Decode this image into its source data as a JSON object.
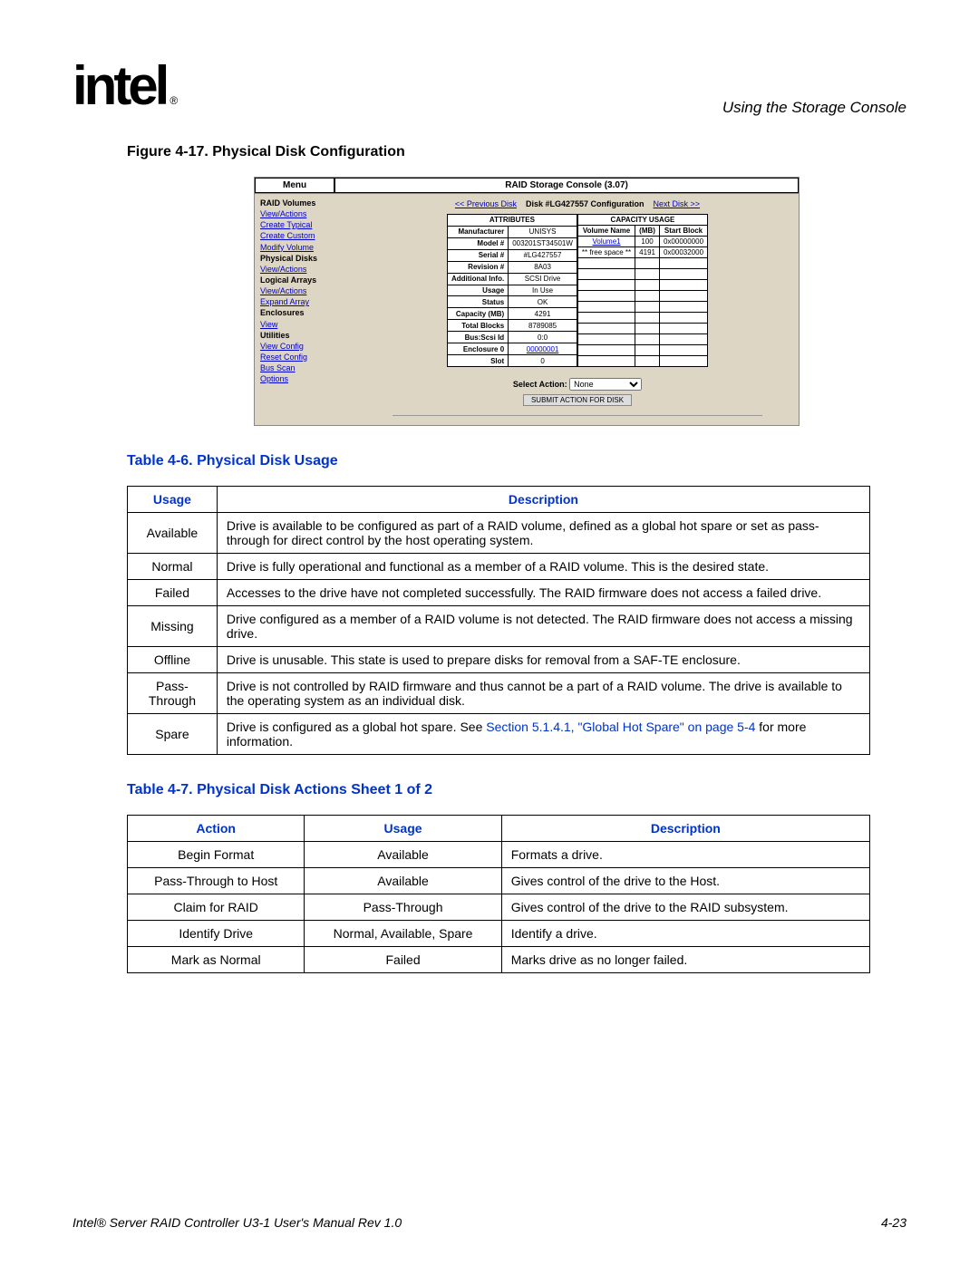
{
  "header": {
    "chapter": "Using the Storage Console",
    "logo_text": "intel",
    "reg": "®"
  },
  "fig_caption": "Figure 4-17. Physical Disk Configuration",
  "screenshot": {
    "menu_label": "Menu",
    "console_title": "RAID Storage Console (3.07)",
    "sidebar": [
      {
        "hdr": "RAID Volumes"
      },
      {
        "lnk": "View/Actions"
      },
      {
        "lnk": "Create Typical"
      },
      {
        "lnk": "Create Custom"
      },
      {
        "lnk": "Modify Volume"
      },
      {
        "hdr": "Physical Disks"
      },
      {
        "lnk": "View/Actions"
      },
      {
        "hdr": "Logical Arrays"
      },
      {
        "lnk": "View/Actions"
      },
      {
        "lnk": "Expand Array"
      },
      {
        "hdr": "Enclosures"
      },
      {
        "lnk": "View"
      },
      {
        "hdr": "Utilities"
      },
      {
        "lnk": "View Config"
      },
      {
        "lnk": "Reset Config"
      },
      {
        "lnk": "Bus Scan"
      },
      {
        "lnk": "Options"
      }
    ],
    "nav": {
      "prev": "<< Previous Disk",
      "title": "Disk #LG427557 Configuration",
      "next": "Next Disk >>"
    },
    "attributes": {
      "header": "ATTRIBUTES",
      "rows": [
        [
          "Manufacturer",
          "UNISYS"
        ],
        [
          "Model #",
          "003201ST34501W"
        ],
        [
          "Serial #",
          "#LG427557"
        ],
        [
          "Revision #",
          "8A03"
        ],
        [
          "Additional Info.",
          "SCSI Drive"
        ],
        [
          "Usage",
          "In Use"
        ],
        [
          "Status",
          "OK"
        ],
        [
          "Capacity (MB)",
          "4291"
        ],
        [
          "Total Blocks",
          "8789085"
        ],
        [
          "Bus:Scsi Id",
          "0:0"
        ],
        [
          "Enclosure 0",
          "00000001"
        ],
        [
          "Slot",
          "0"
        ]
      ]
    },
    "capacity": {
      "header": "CAPACITY USAGE",
      "cols": [
        "Volume Name",
        "(MB)",
        "Start Block"
      ],
      "rows": [
        [
          "Volume1",
          "100",
          "0x00000000"
        ],
        [
          "** free space **",
          "4191",
          "0x00032000"
        ]
      ]
    },
    "action": {
      "label": "Select Action:",
      "value": "None",
      "submit": "SUBMIT ACTION FOR DISK"
    }
  },
  "table46": {
    "caption": "Table 4-6. Physical Disk Usage",
    "headers": [
      "Usage",
      "Description"
    ],
    "rows": [
      [
        "Available",
        "Drive is available to be configured as part of a RAID volume, defined as a global hot spare or set as pass-through for direct control by the host operating system."
      ],
      [
        "Normal",
        "Drive is fully operational and functional as a member of a RAID volume. This is the desired state."
      ],
      [
        "Failed",
        "Accesses to the drive have not completed successfully. The RAID firmware does not access a failed drive."
      ],
      [
        "Missing",
        "Drive configured as a member of a RAID volume is not detected. The RAID firmware does not access a missing drive."
      ],
      [
        "Offline",
        "Drive is unusable. This state is used to prepare disks for removal from a SAF-TE enclosure."
      ],
      [
        "Pass-Through",
        "Drive is not controlled by RAID firmware and thus cannot be a part of a RAID volume. The drive is available to the operating system as an individual disk."
      ],
      [
        "Spare",
        "Drive is configured as a global hot spare. See |Section 5.1.4.1, \"Global Hot Spare\" on page 5-4| for more information."
      ]
    ]
  },
  "table47": {
    "caption": "Table 4-7. Physical Disk Actions  Sheet 1 of 2",
    "headers": [
      "Action",
      "Usage",
      "Description"
    ],
    "rows": [
      [
        "Begin Format",
        "Available",
        "Formats a drive."
      ],
      [
        "Pass-Through to Host",
        "Available",
        "Gives control of the drive to the Host."
      ],
      [
        "Claim for RAID",
        "Pass-Through",
        "Gives control of the drive to the RAID subsystem."
      ],
      [
        "Identify Drive",
        "Normal, Available, Spare",
        "Identify a drive."
      ],
      [
        "Mark as Normal",
        "Failed",
        "Marks drive as no longer failed."
      ]
    ]
  },
  "footer": {
    "left": "Intel® Server RAID Controller U3-1 User's Manual Rev 1.0",
    "right": "4-23"
  }
}
